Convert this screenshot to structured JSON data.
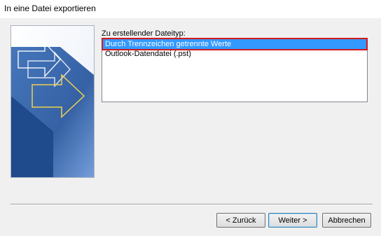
{
  "window": {
    "title": "In eine Datei exportieren"
  },
  "form": {
    "prompt": "Zu erstellender Dateityp:",
    "file_types": [
      {
        "label": "Durch Trennzeichen getrennte Werte",
        "selected": true
      },
      {
        "label": "Outlook-Datendatei (.pst)",
        "selected": false
      }
    ]
  },
  "buttons": {
    "back": "< Zurück",
    "next": "Weiter >",
    "cancel": "Abbrechen"
  },
  "colors": {
    "selection": "#3399ff",
    "highlight_outline": "#d21a1a",
    "art_blue": "#2c5aa0",
    "arrow_yellow": "#f0d050"
  }
}
